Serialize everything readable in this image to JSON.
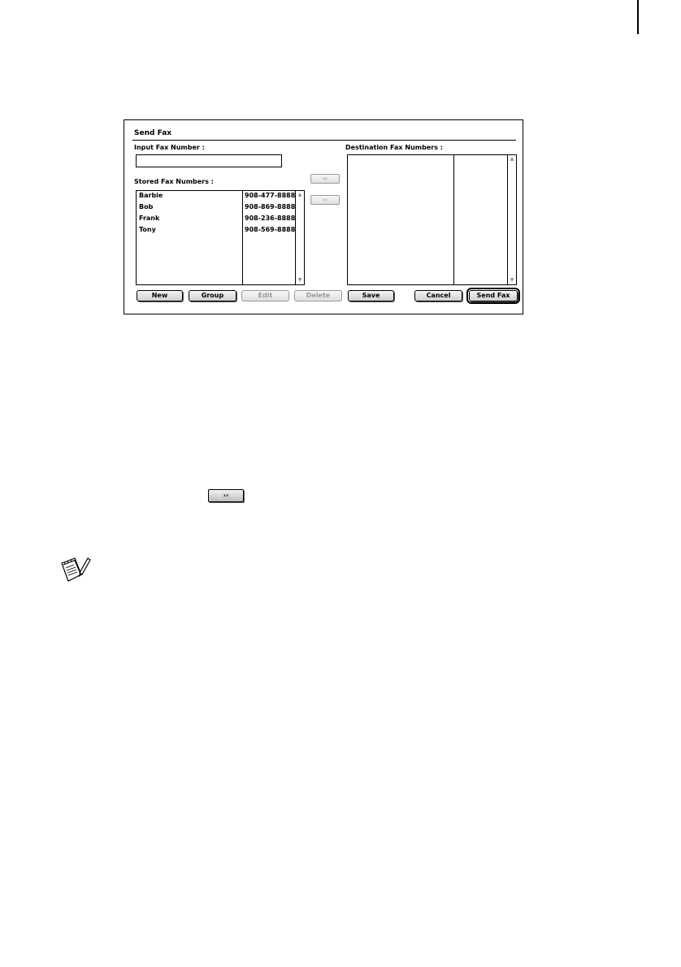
{
  "dialog": {
    "title": "Send Fax",
    "input_label": "Input Fax Number :",
    "input_value": "",
    "stored_label": "Stored Fax Numbers :",
    "destination_label": "Destination Fax Numbers :",
    "add_arrow": "››",
    "remove_arrow": "‹‹",
    "stored_entries": [
      {
        "name": "Barbie",
        "number": "908-477-8888"
      },
      {
        "name": "Bob",
        "number": "908-869-8888"
      },
      {
        "name": "Frank",
        "number": "908-236-8888"
      },
      {
        "name": "Tony",
        "number": "908-569-8888"
      }
    ],
    "buttons": {
      "new": "New",
      "group": "Group",
      "edit": "Edit",
      "delete": "Delete",
      "save": "Save",
      "cancel": "Cancel",
      "send_fax": "Send Fax"
    }
  },
  "standalone_button": {
    "label": "››"
  },
  "icons": {
    "note": "note-pad-icon"
  }
}
